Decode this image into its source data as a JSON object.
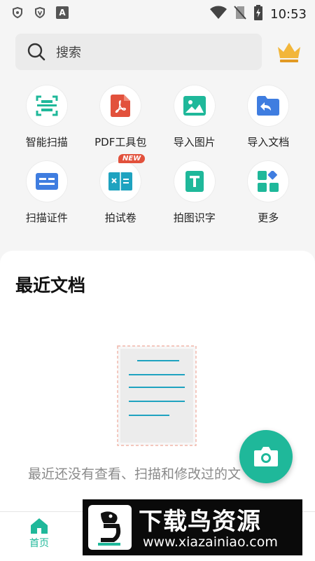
{
  "status_bar": {
    "time": "10:53",
    "notification_letter": "A"
  },
  "search": {
    "placeholder": "搜索"
  },
  "tools": [
    {
      "label": "智能扫描",
      "icon": "scan-icon"
    },
    {
      "label": "PDF工具包",
      "icon": "pdf-icon"
    },
    {
      "label": "导入图片",
      "icon": "image-icon"
    },
    {
      "label": "导入文档",
      "icon": "folder-import-icon"
    },
    {
      "label": "扫描证件",
      "icon": "id-card-icon"
    },
    {
      "label": "拍试卷",
      "icon": "exam-paper-icon",
      "badge": "NEW"
    },
    {
      "label": "拍图识字",
      "icon": "text-recognition-icon"
    },
    {
      "label": "更多",
      "icon": "more-grid-icon"
    }
  ],
  "recent": {
    "title": "最近文档",
    "empty_text": "最近还没有查看、扫描和修改过的文"
  },
  "bottom_nav": {
    "home_label": "首页"
  },
  "watermark": {
    "title": "下载鸟资源",
    "url": "www.xiazainiao.com"
  },
  "colors": {
    "accent": "#1fb89a",
    "pdf_red": "#e2513c",
    "blue": "#3f7de0",
    "crown_gold": "#f2b63a"
  }
}
